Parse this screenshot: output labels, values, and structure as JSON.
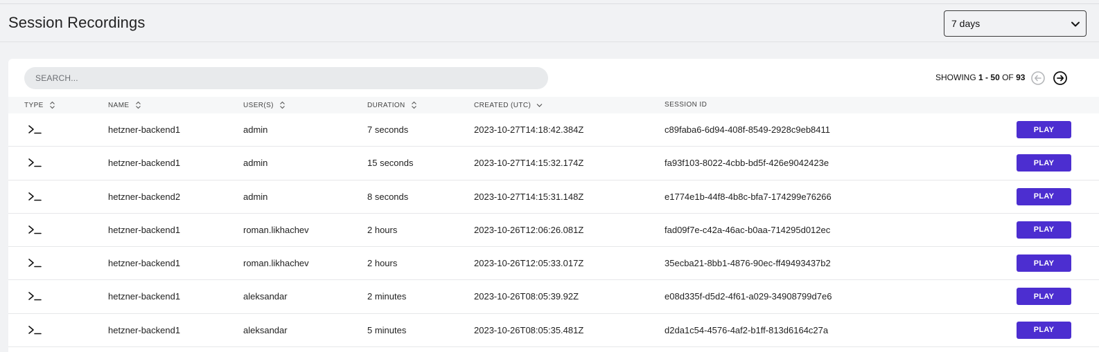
{
  "header": {
    "title": "Session Recordings",
    "range_select": {
      "value": "7 days",
      "icon": "chevron-down-icon"
    }
  },
  "toolbar": {
    "search_placeholder": "SEARCH...",
    "pager": {
      "prefix": "SHOWING",
      "start": "1",
      "dash": "-",
      "end": "50",
      "of": "OF",
      "total": "93"
    }
  },
  "columns": {
    "type": "TYPE",
    "name": "NAME",
    "users": "USER(S)",
    "duration": "DURATION",
    "created": "CREATED (UTC)",
    "session_id": "SESSION ID"
  },
  "rows": [
    {
      "type_icon": "terminal-icon",
      "name": "hetzner-backend1",
      "user": "admin",
      "duration": "7 seconds",
      "created": "2023-10-27T14:18:42.384Z",
      "session_id": "c89faba6-6d94-408f-8549-2928c9eb8411",
      "action": "PLAY"
    },
    {
      "type_icon": "terminal-icon",
      "name": "hetzner-backend1",
      "user": "admin",
      "duration": "15 seconds",
      "created": "2023-10-27T14:15:32.174Z",
      "session_id": "fa93f103-8022-4cbb-bd5f-426e9042423e",
      "action": "PLAY"
    },
    {
      "type_icon": "terminal-icon",
      "name": "hetzner-backend2",
      "user": "admin",
      "duration": "8 seconds",
      "created": "2023-10-27T14:15:31.148Z",
      "session_id": "e1774e1b-44f8-4b8c-bfa7-174299e76266",
      "action": "PLAY"
    },
    {
      "type_icon": "terminal-icon",
      "name": "hetzner-backend1",
      "user": "roman.likhachev",
      "duration": "2 hours",
      "created": "2023-10-26T12:06:26.081Z",
      "session_id": "fad09f7e-c42a-46ac-b0aa-714295d012ec",
      "action": "PLAY"
    },
    {
      "type_icon": "terminal-icon",
      "name": "hetzner-backend1",
      "user": "roman.likhachev",
      "duration": "2 hours",
      "created": "2023-10-26T12:05:33.017Z",
      "session_id": "35ecba21-8bb1-4876-90ec-ff49493437b2",
      "action": "PLAY"
    },
    {
      "type_icon": "terminal-icon",
      "name": "hetzner-backend1",
      "user": "aleksandar",
      "duration": "2 minutes",
      "created": "2023-10-26T08:05:39.92Z",
      "session_id": "e08d335f-d5d2-4f61-a029-34908799d7e6",
      "action": "PLAY"
    },
    {
      "type_icon": "terminal-icon",
      "name": "hetzner-backend1",
      "user": "aleksandar",
      "duration": "5 minutes",
      "created": "2023-10-26T08:05:35.481Z",
      "session_id": "d2da1c54-4576-4af2-b1ff-813d6164c27a",
      "action": "PLAY"
    }
  ],
  "colors": {
    "accent": "#4c2ed0",
    "background": "#f1f2f4",
    "card": "#ffffff"
  }
}
